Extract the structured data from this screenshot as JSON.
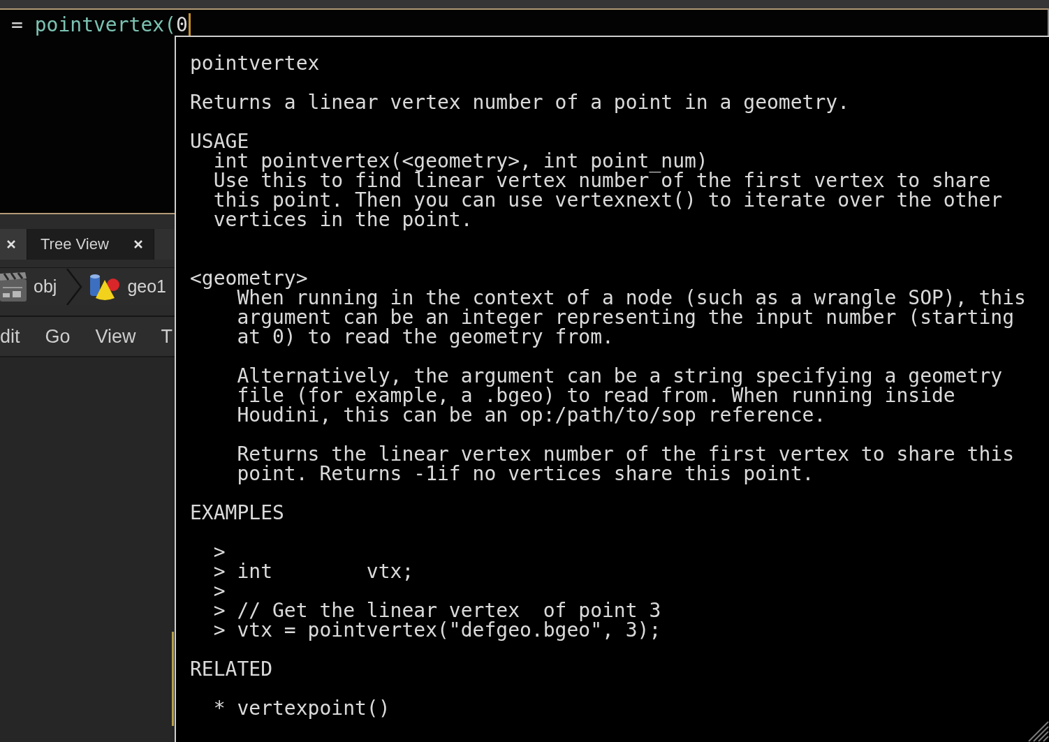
{
  "editor": {
    "focused": true,
    "tokens": [
      {
        "text": "= ",
        "kind": "operator"
      },
      {
        "text": "pointvertex(",
        "kind": "function"
      },
      {
        "text": "0",
        "kind": "number"
      }
    ]
  },
  "pane": {
    "tabs": [
      {
        "selected": true
      },
      {
        "label": "Tree View",
        "selected": false
      }
    ],
    "path": [
      {
        "label": "obj",
        "kind": "network"
      },
      {
        "label": "geo1",
        "kind": "geometry"
      }
    ],
    "menu": [
      "dit",
      "Go",
      "View",
      "T"
    ]
  },
  "help": {
    "title": "pointvertex",
    "summary": "Returns a linear vertex number of a point in a geometry.",
    "usage": {
      "heading": "USAGE",
      "signature": "int pointvertex(<geometry>, int point_num)",
      "description": [
        "Use this to find linear vertex number of the first vertex to share",
        "this point. Then you can use vertexnext() to iterate over the other",
        "vertices in the point."
      ]
    },
    "arguments": [
      {
        "name": "<geometry>",
        "paragraphs": [
          [
            "When running in the context of a node (such as a wrangle SOP), this",
            "argument can be an integer representing the input number (starting",
            "at 0) to read the geometry from."
          ],
          [
            "Alternatively, the argument can be a string specifying a geometry",
            "file (for example, a .bgeo) to read from. When running inside",
            "Houdini, this can be an op:/path/to/sop reference."
          ],
          [
            "Returns the linear vertex number of the first vertex to share this",
            "point. Returns -1if no vertices share this point."
          ]
        ]
      }
    ],
    "examples": {
      "heading": "EXAMPLES",
      "lines": [
        ">",
        "> int        vtx;",
        ">",
        "> // Get the linear vertex  of point 3",
        "> vtx = pointvertex(\"defgeo.bgeo\", 3);"
      ]
    },
    "related": {
      "heading": "RELATED",
      "items": [
        "* vertexpoint()"
      ]
    }
  }
}
